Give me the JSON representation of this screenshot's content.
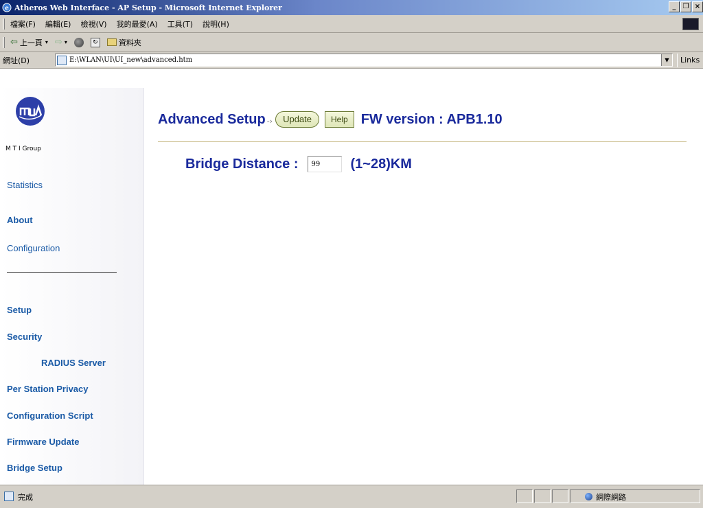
{
  "window": {
    "title": "Atheros Web Interface - AP Setup - Microsoft Internet Explorer",
    "minimize": "_",
    "maximize": "❐",
    "close": "×"
  },
  "menubar": {
    "items": [
      "檔案(F)",
      "編輯(E)",
      "檢視(V)",
      "我的最愛(A)",
      "工具(T)",
      "說明(H)"
    ]
  },
  "navbar": {
    "back_label": "上一頁",
    "favorites_label": "資料夾"
  },
  "address": {
    "label": "網址(D)",
    "url": "E:\\WLAN\\UI\\UI_new\\advanced.htm",
    "links_label": "Links"
  },
  "sidebar": {
    "logo_text": "M T I Group",
    "links": [
      "Statistics",
      "About",
      "Configuration"
    ],
    "sub_links": [
      "Setup",
      "Security",
      "RADIUS Server",
      "Per Station Privacy",
      "Configuration Script",
      "Firmware Update",
      "Bridge Setup"
    ]
  },
  "main": {
    "title": "Advanced Setup",
    "arrow": "-›",
    "update_label": "Update",
    "help_label": "Help",
    "fw_label": "FW version : APB1.10",
    "bridge_label": "Bridge Distance :",
    "bridge_value": "99",
    "bridge_range": "(1~28)KM"
  },
  "status": {
    "text": "完成",
    "zone": "網際網路"
  },
  "colors": {
    "accent": "#1a2a9c",
    "link": "#1a5aa6",
    "titlebar": "#0a246a",
    "chrome": "#d4d0c8"
  }
}
